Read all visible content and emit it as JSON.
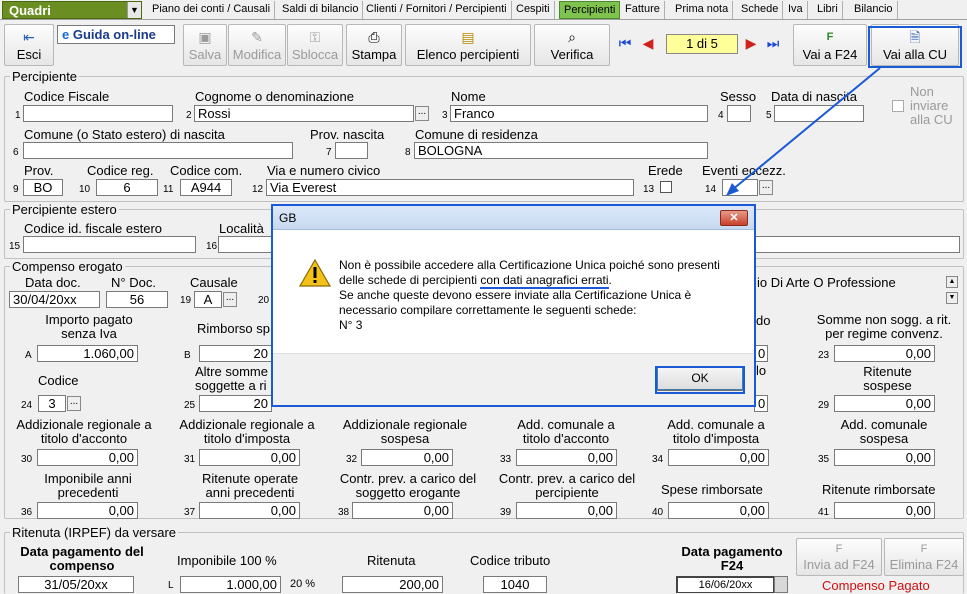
{
  "module_select": "Quadri",
  "tabs": [
    "Piano dei conti / Causali",
    "Saldi di bilancio",
    "Clienti / Fornitori / Percipienti",
    "Cespiti",
    "Percipienti",
    "Fatture",
    "Prima nota",
    "Schede",
    "Iva",
    "Libri",
    "Bilancio"
  ],
  "active_tab": "Percipienti",
  "toolbar": {
    "esci": "Esci",
    "help": "Guida on-line",
    "salva": "Salva",
    "modifica": "Modifica",
    "sblocca": "Sblocca",
    "stampa": "Stampa",
    "elenco": "Elenco percipienti",
    "verifica": "Verifica",
    "record": "1 di 5",
    "vai_f24": "Vai a F24",
    "vai_cu": "Vai alla CU"
  },
  "percipiente": {
    "title": "Percipiente",
    "codice_fiscale_label": "Codice Fiscale",
    "codice_fiscale": "",
    "cognome_label": "Cognome o denominazione",
    "cognome": "Rossi",
    "nome_label": "Nome",
    "nome": "Franco",
    "sesso_label": "Sesso",
    "sesso": "",
    "data_nascita_label": "Data di nascita",
    "data_nascita": "",
    "non_inviare_label": "Non inviare alla CU",
    "comune_nascita_label": "Comune (o Stato estero) di nascita",
    "comune_nascita": "",
    "prov_nascita_label": "Prov. nascita",
    "prov_nascita": "",
    "comune_residenza_label": "Comune di residenza",
    "comune_residenza": "BOLOGNA",
    "prov_label": "Prov.",
    "prov": "BO",
    "codice_reg_label": "Codice reg.",
    "codice_reg": "6",
    "codice_com_label": "Codice com.",
    "codice_com": "A944",
    "via_label": "Via e numero civico",
    "via": "Via Everest",
    "erede_label": "Erede",
    "eventi_label": "Eventi eccezz.",
    "eventi": "",
    "nums": {
      "n1": "1",
      "n2": "2",
      "n3": "3",
      "n4": "4",
      "n5": "5",
      "n6": "6",
      "n7": "7",
      "n8": "8",
      "n9": "9",
      "n10": "10",
      "n11": "11",
      "n12": "12",
      "n13": "13",
      "n14": "14"
    }
  },
  "estero": {
    "title": "Percipiente estero",
    "codice_label": "Codice id. fiscale estero",
    "localita_label": "Località",
    "n15": "15",
    "n16": "16"
  },
  "compenso": {
    "title": "Compenso erogato",
    "data_doc_label": "Data doc.",
    "data_doc": "30/04/20xx",
    "n_doc_label": "N° Doc.",
    "n_doc": "56",
    "causale_label": "Causale",
    "causale": "A",
    "causale_desc": "io Di Arte O Professione",
    "n19": "19",
    "n20": "20",
    "importo_label": "Importo pagato senza Iva",
    "importo": "1.060,00",
    "rimborso_label": "Rimborso sp",
    "rimborso": "20",
    "somme_label": "Somme non sogg. a rit. per regime convenz.",
    "somme": "0,00",
    "col_do_label": "do",
    "col_do": "0",
    "codice_label": "Codice",
    "codice": "3",
    "altre_label": "Altre somme soggette a ri",
    "altre": "20",
    "col_lo_label": "lo",
    "col_lo": "0",
    "ritenute_sospese_label": "Ritenute sospese",
    "ritenute_sospese": "0,00",
    "nA": "A",
    "nB": "B",
    "n23": "23",
    "n24": "24",
    "n25": "25",
    "n29": "29",
    "add_reg_acc_label": "Addizionale regionale a titolo d'acconto",
    "add_reg_acc": "0,00",
    "add_reg_imp_label": "Addizionale regionale a titolo d'imposta",
    "add_reg_imp": "0,00",
    "add_reg_sosp_label": "Addizionale regionale sospesa",
    "add_reg_sosp": "0,00",
    "add_com_acc_label": "Add. comunale a titolo d'acconto",
    "add_com_acc": "0,00",
    "add_com_imp_label": "Add. comunale a titolo d'imposta",
    "add_com_imp": "0,00",
    "add_com_sosp_label": "Add. comunale sospesa",
    "add_com_sosp": "0,00",
    "n30": "30",
    "n31": "31",
    "n32": "32",
    "n33": "33",
    "n34": "34",
    "n35": "35",
    "imponibile_prec_label": "Imponibile anni precedenti",
    "imponibile_prec": "0,00",
    "ritenute_prec_label": "Ritenute operate anni precedenti",
    "ritenute_prec": "0,00",
    "contr_sogg_label": "Contr. prev. a carico del soggetto erogante",
    "contr_sogg": "0,00",
    "contr_perc_label": "Contr. prev. a carico del percipiente",
    "contr_perc": "0,00",
    "spese_label": "Spese rimborsate",
    "spese": "0,00",
    "rit_rimb_label": "Ritenute rimborsate",
    "rit_rimb": "0,00",
    "n36": "36",
    "n37": "37",
    "n38": "38",
    "n39": "39",
    "n40": "40",
    "n41": "41"
  },
  "ritenuta": {
    "title": "Ritenuta (IRPEF) da versare",
    "data_pag_label": "Data pagamento del compenso",
    "data_pag": "31/05/20xx",
    "imponibile_label": "Imponibile 100 %",
    "imponibile": "1.000,00",
    "nL": "L",
    "perc": "20 %",
    "ritenuta_label": "Ritenuta",
    "ritenuta": "200,00",
    "codice_tributo_label": "Codice tributo",
    "codice_tributo": "1040",
    "data_f24_label": "Data pagamento F24",
    "data_f24": "16/06/20xx",
    "invia_f24": "Invia ad F24",
    "elimina_f24": "Elimina F24",
    "status": "Compenso Pagato"
  },
  "dialog": {
    "title": "GB",
    "line1": "Non è possibile accedere alla Certificazione Unica poiché sono presenti",
    "line2a": "delle schede di percipienti ",
    "line2b": "con dati anagrafici errati",
    "line2c": ".",
    "line3": "Se anche queste devono essere inviate alla Certificazione Unica è",
    "line4": "necessario compilare correttamente le seguenti schede:",
    "line5": "N° 3",
    "ok": "OK"
  },
  "colors": {
    "accent": "#1a5ad6",
    "active_tab": "#7fc24e",
    "record_box": "#ffff99",
    "status": "#d01010"
  }
}
